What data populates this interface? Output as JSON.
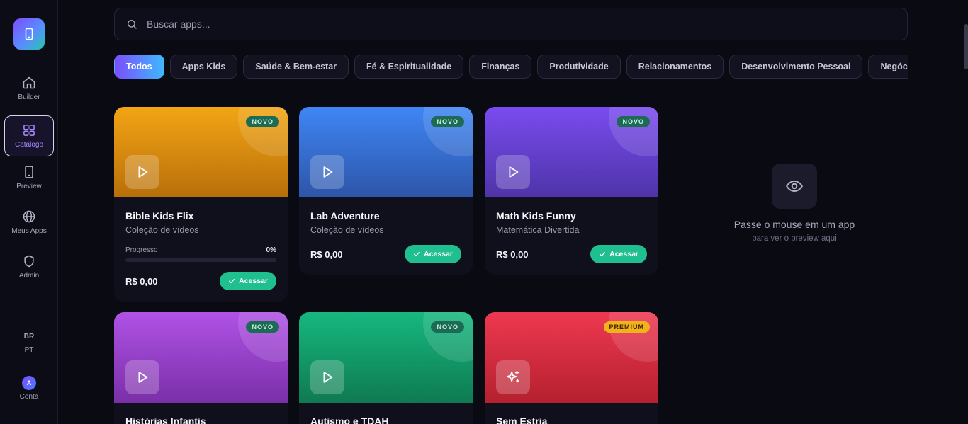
{
  "sidebar": {
    "items": [
      {
        "label": "Builder",
        "icon": "home-icon"
      },
      {
        "label": "Catálogo",
        "icon": "grid-icon"
      },
      {
        "label": "Preview",
        "icon": "phone-icon"
      },
      {
        "label": "Meus Apps",
        "icon": "globe-icon"
      },
      {
        "label": "Admin",
        "icon": "shield-icon"
      }
    ],
    "lang_country": "BR",
    "lang_code": "PT",
    "avatar_initial": "A",
    "account_label": "Conta"
  },
  "search": {
    "placeholder": "Buscar apps..."
  },
  "categories": [
    "Todos",
    "Apps Kids",
    "Saúde & Bem-estar",
    "Fé & Espiritualidade",
    "Finanças",
    "Produtividade",
    "Relacionamentos",
    "Desenvolvimento Pessoal",
    "Negócios"
  ],
  "cards": [
    {
      "title": "Bible Kids Flix",
      "subtitle": "Coleção de vídeos",
      "badge": "NOVO",
      "progress_label": "Progresso",
      "progress_value": "0%",
      "progress_fraction": 0,
      "price": "R$ 0,00",
      "action": "Acessar",
      "icon": "play-icon",
      "colors": [
        "#f3a514",
        "#b86f0a"
      ]
    },
    {
      "title": "Lab Adventure",
      "subtitle": "Coleção de vídeos",
      "badge": "NOVO",
      "price": "R$ 0,00",
      "action": "Acessar",
      "icon": "play-icon",
      "colors": [
        "#3f86f5",
        "#2d55a8"
      ]
    },
    {
      "title": "Math Kids Funny",
      "subtitle": "Matemática Divertida",
      "badge": "NOVO",
      "price": "R$ 0,00",
      "action": "Acessar",
      "icon": "play-icon",
      "colors": [
        "#7a4bef",
        "#4e34a8"
      ]
    },
    {
      "title": "Histórias Infantis",
      "badge": "NOVO",
      "icon": "play-icon",
      "colors": [
        "#b052e6",
        "#7a2fa8"
      ]
    },
    {
      "title": "Autismo e TDAH",
      "badge": "NOVO",
      "icon": "play-icon",
      "colors": [
        "#16b87f",
        "#0f7a52"
      ]
    },
    {
      "title": "Sem Estria",
      "badge": "PREMIUM",
      "icon": "sparkle-icon",
      "colors": [
        "#ee3850",
        "#b5202f"
      ]
    }
  ],
  "preview": {
    "title": "Passe o mouse em um app",
    "subtitle": "para ver o preview aqui",
    "icon": "eye-icon"
  },
  "colors": {
    "accent": "#7b4dff",
    "success": "#1fbf8f",
    "background": "#0a0a12"
  }
}
